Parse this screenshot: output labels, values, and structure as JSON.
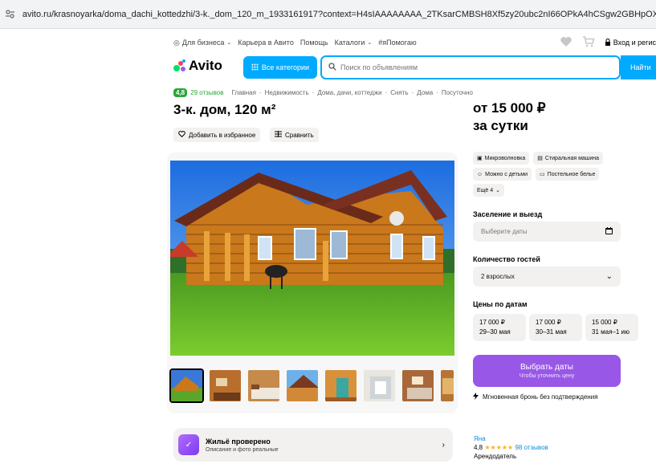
{
  "browser": {
    "url": "avito.ru/krasnoyarka/doma_dachi_kottedzhi/3-k._dom_120_m_1933161917?context=H4sIAAAAAAAA_2TKsarCMBSH8Xf5zy20ubc2nI66OPkA4hCSgw2GBHpOXErfXSqCg-vv-xz90So0E"
  },
  "topnav": {
    "business": "Для бизнеса",
    "career": "Карьера в Авито",
    "help": "Помощь",
    "catalogs": "Каталоги",
    "tag": "#яПомогаю",
    "login": "Вход и регис"
  },
  "header": {
    "logo": "Avito",
    "categories": "Все категории",
    "search_placeholder": "Поиск по объявлениям",
    "find": "Найти"
  },
  "breadcrumbs": {
    "rating": "4,8",
    "reviews": "29 отзывов",
    "items": [
      "Главная",
      "Недвижимость",
      "Дома, дачи, коттеджи",
      "Снять",
      "Дома",
      "Посуточно"
    ]
  },
  "listing": {
    "title": "3-к. дом, 120 м²",
    "favorite": "Добавить в избранное",
    "compare": "Сравнить",
    "price_line1": "от 15 000 ₽",
    "price_line2": "за сутки"
  },
  "amenities": [
    "Микроволновка",
    "Стиральная машина",
    "Можно с детьми",
    "Постельное белье",
    "Ещё 4"
  ],
  "booking": {
    "dates_label": "Заселение и выезд",
    "dates_placeholder": "Выберите даты",
    "guests_label": "Количество гостей",
    "guests_value": "2 взрослых",
    "prices_label": "Цены по датам",
    "price_cards": [
      {
        "price": "17 000 ₽",
        "dates": "29–30 мая"
      },
      {
        "price": "17 000 ₽",
        "dates": "30–31 мая"
      },
      {
        "price": "15 000 ₽",
        "dates": "31 мая–1 ию"
      }
    ],
    "select_dates": "Выбрать даты",
    "select_hint": "Чтобы уточнить цену",
    "instant": "Мгновенная бронь без подтверждения"
  },
  "verified": {
    "title": "Жильё проверено",
    "subtitle": "Описание и фото реальные"
  },
  "host": {
    "name": "Яна",
    "rating": "4,8",
    "stars": "★★★★★",
    "reviews": "98 отзывов",
    "role": "Арендодатель"
  },
  "colors": {
    "accent": "#00aaff",
    "green": "#2ba63b",
    "purple": "#9957e8"
  }
}
